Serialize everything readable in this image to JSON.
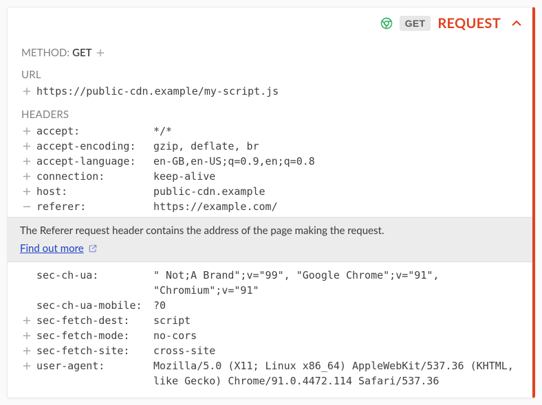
{
  "header": {
    "method_badge": "GET",
    "title": "REQUEST"
  },
  "method": {
    "label": "METHOD:",
    "value": "GET"
  },
  "url": {
    "label": "URL",
    "value": "https://public-cdn.example/my-script.js"
  },
  "headers_label": "HEADERS",
  "headers_top": [
    {
      "key": "accept:",
      "value": "*/*",
      "icon": "plus"
    },
    {
      "key": "accept-encoding:",
      "value": "gzip, deflate, br",
      "icon": "plus"
    },
    {
      "key": "accept-language:",
      "value": "en-GB,en-US;q=0.9,en;q=0.8",
      "icon": "plus"
    },
    {
      "key": "connection:",
      "value": "keep-alive",
      "icon": "plus"
    },
    {
      "key": "host:",
      "value": "public-cdn.example",
      "icon": "plus"
    },
    {
      "key": "referer:",
      "value": "https://example.com/",
      "icon": "minus"
    }
  ],
  "info": {
    "text": "The Referer request header contains the address of the page making the request.",
    "link_label": "Find out more"
  },
  "headers_bottom": [
    {
      "key": "sec-ch-ua:",
      "value": "\" Not;A Brand\";v=\"99\", \"Google Chrome\";v=\"91\", \"Chromium\";v=\"91\"",
      "icon": "none"
    },
    {
      "key": "sec-ch-ua-mobile:",
      "value": "?0",
      "icon": "none"
    },
    {
      "key": "sec-fetch-dest:",
      "value": "script",
      "icon": "plus"
    },
    {
      "key": "sec-fetch-mode:",
      "value": "no-cors",
      "icon": "plus"
    },
    {
      "key": "sec-fetch-site:",
      "value": "cross-site",
      "icon": "plus"
    },
    {
      "key": "user-agent:",
      "value": "Mozilla/5.0 (X11; Linux x86_64) AppleWebKit/537.36 (KHTML, like Gecko) Chrome/91.0.4472.114 Safari/537.36",
      "icon": "plus"
    }
  ]
}
